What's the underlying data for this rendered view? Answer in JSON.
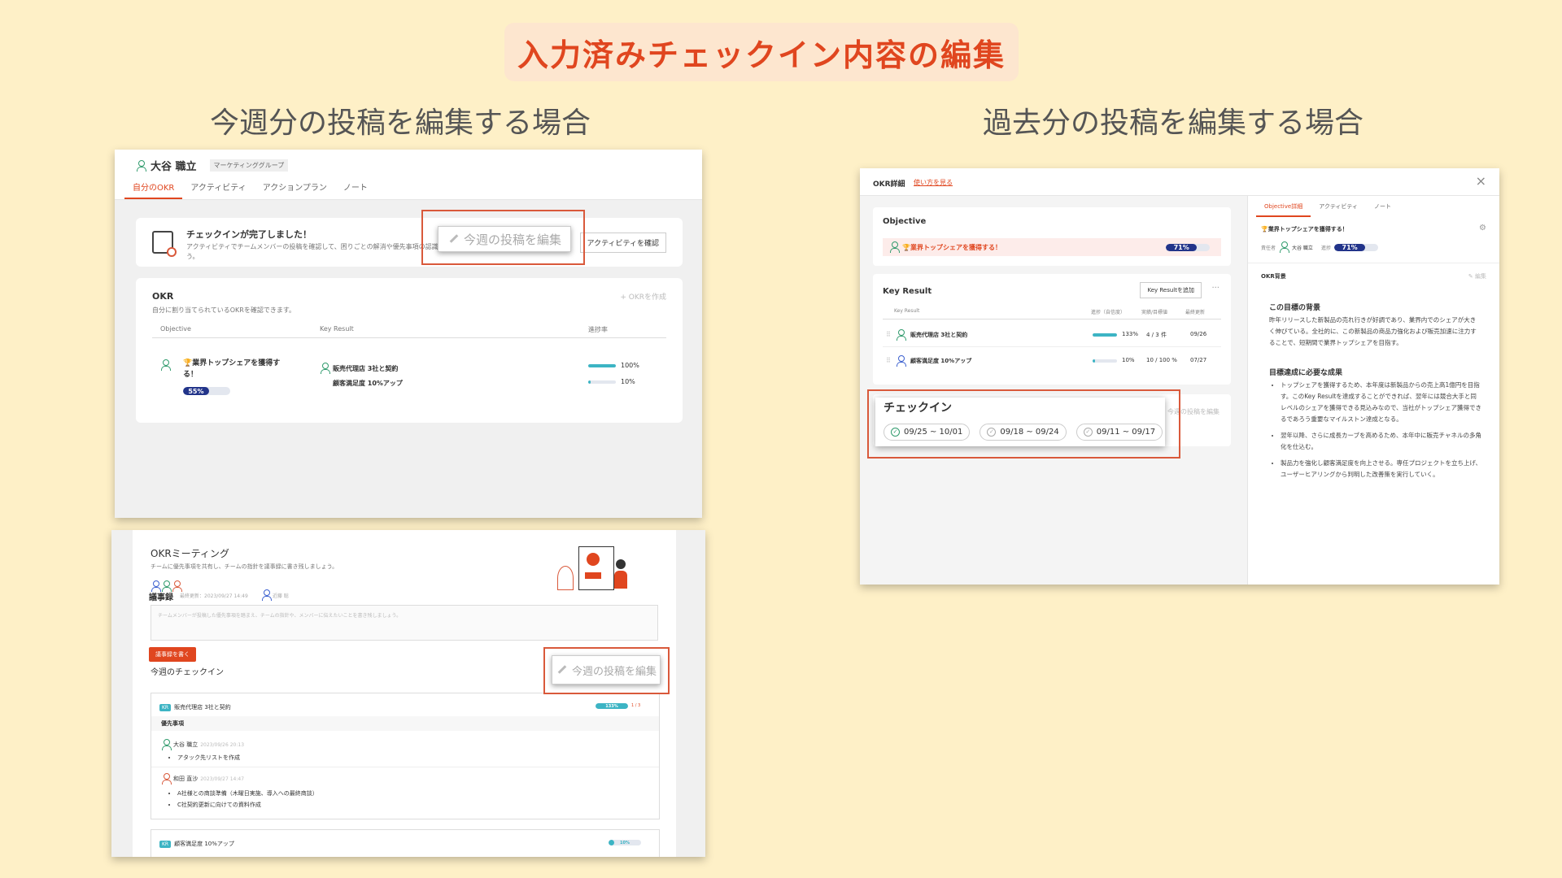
{
  "slide": {
    "title": "入力済みチェックイン内容の編集",
    "left_heading": "今週分の投稿を編集する場合",
    "right_heading": "過去分の投稿を編集する場合"
  },
  "shot1": {
    "user_name": "大谷 職立",
    "group_badge": "マーケティンググループ",
    "tabs": [
      "自分のOKR",
      "アクティビティ",
      "アクションプラン",
      "ノート"
    ],
    "checkin_title": "チェックインが完了しました！",
    "checkin_desc": "アクティビティでチームメンバーの投稿を確認して、困りごとの解消や優先事項の認識",
    "checkin_desc2": "う。",
    "edit_button": "今週の投稿を編集",
    "activity_button": "アクティビティを確認",
    "okr_title": "OKR",
    "okr_desc": "自分に割り当てられているOKRを確認できます。",
    "create_okr": "+ OKRを作成",
    "col_objective": "Objective",
    "col_kr": "Key Result",
    "col_progress": "進捗率",
    "objective_text": "🏆業界トップシェアを獲得する！",
    "objective_progress": "55%",
    "objective_progress_value": 55,
    "key_results": [
      {
        "name": "販売代理店 3社と契約",
        "progress": "100%",
        "value": 100
      },
      {
        "name": "顧客満足度 10%アップ",
        "progress": "10%",
        "value": 10
      }
    ]
  },
  "shot2": {
    "title": "OKRミーティング",
    "desc": "チームに優先事項を共有し、チームの指針を議事録に書き残しましょう。",
    "minutes_label": "議事録",
    "minutes_meta": "最終更新：2023/09/27 14:49",
    "minutes_author": "近藤 聡",
    "placeholder": "チームメンバーが投稿した優先事項を踏まえ、チームの指針や、メンバーに伝えたいことを書き残しましょう。",
    "write_button": "議事録を書く",
    "edit_button": "今週の投稿を編集",
    "week_checkin": "今週のチェックイン",
    "kr1_badge": "KR",
    "kr1_name": "販売代理店 3社と契約",
    "kr1_progress": "133%",
    "kr1_count": "1 / 3",
    "priority_label": "優先事項",
    "post1_name": "大谷 職立",
    "post1_time": "2023/09/26 20:13",
    "post1_items": [
      "アタック先リストを作成"
    ],
    "post2_name": "和田 直沙",
    "post2_time": "2023/09/27 14:47",
    "post2_items": [
      "A社様との商談準備（木曜日実施、導入への最終商談）",
      "C社契約更新に向けての資料作成"
    ],
    "kr2_badge": "KR",
    "kr2_name": "顧客満足度 10%アップ",
    "kr2_progress": "10%"
  },
  "shot3": {
    "header_title": "OKR詳細",
    "header_link": "使い方を見る",
    "objective_label": "Objective",
    "objective_text": "🏆業界トップシェアを獲得する！",
    "objective_progress": "71%",
    "objective_progress_value": 71,
    "kr_section": "Key Result",
    "add_kr_button": "Key Resultを追加",
    "kr_cols": [
      "Key Result",
      "進捗（自信度）",
      "実績/目標値",
      "最終更新"
    ],
    "key_results": [
      {
        "name": "販売代理店 3社と契約",
        "progress": "133%",
        "value": 100,
        "actual": "4 / 3 件",
        "updated": "09/26"
      },
      {
        "name": "顧客満足度 10%アップ",
        "progress": "10%",
        "value": 10,
        "actual": "10 / 100 %",
        "updated": "07/27"
      }
    ],
    "checkin_label": "チェックイン",
    "checkin_edit": "今週の投稿を編集",
    "checkin_weeks": [
      "09/25 ~ 10/01",
      "09/18 ~ 09/24",
      "09/11 ~ 09/17"
    ],
    "right_tabs": [
      "Objective詳細",
      "アクティビティ",
      "ノート"
    ],
    "right_objective": "🏆業界トップシェアを獲得する！",
    "owner_label": "責任者",
    "owner_name": "大谷 職立",
    "progress_label": "進捗",
    "right_progress": "71%",
    "background_label": "OKR背景",
    "edit_label": "編集",
    "bg_heading": "この目標の背景",
    "bg_text": "昨年リリースした新製品の売れ行きが好調であり、業界内でのシェアが大きく伸びている。全社的に、この新製品の商品力強化および販売加速に注力することで、短期間で業界トップシェアを目指す。",
    "results_heading": "目標達成に必要な成果",
    "results": [
      "トップシェアを獲得するため、本年度は新製品からの売上高1億円を目指す。このKey Resultを達成することができれば、翌年には競合大手と同レベルのシェアを獲得できる見込みなので、当社がトップシェア獲得できるであろう重要なマイルストン達成となる。",
      "翌年以降、さらに成長カーブを高めるため、本年中に販売チャネルの多角化を仕込む。",
      "製品力を強化し顧客満足度を向上させる。専任プロジェクトを立ち上げ、ユーザーヒアリングから判明した改善策を実行していく。"
    ]
  },
  "colors": {
    "accent": "#e0461f",
    "navy": "#22348a",
    "teal": "#3cb4c4",
    "highlight": "#d9593b"
  }
}
